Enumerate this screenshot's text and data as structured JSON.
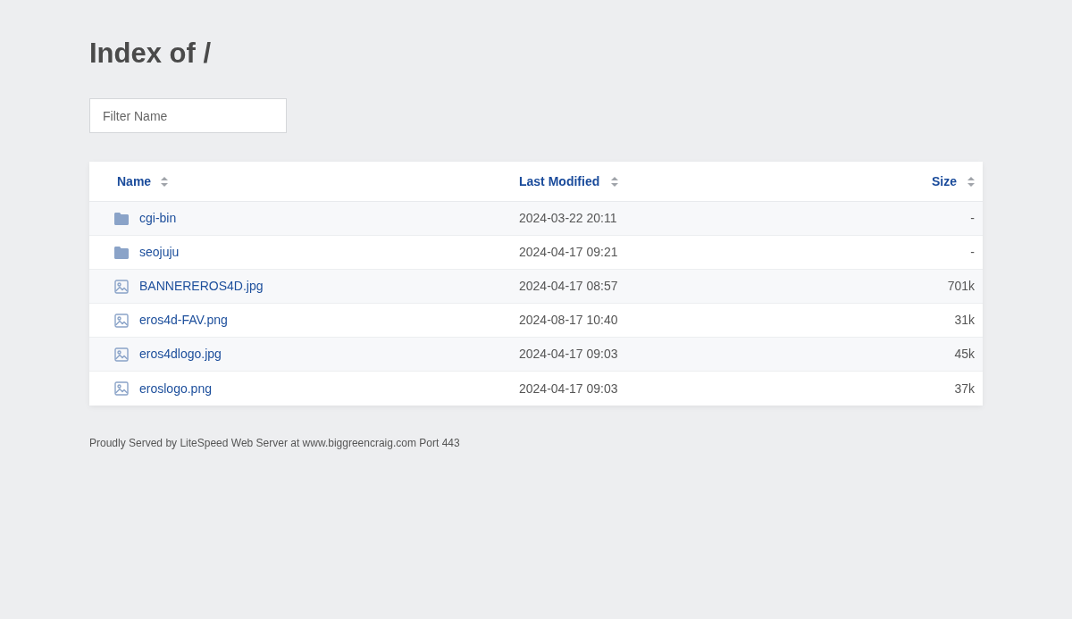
{
  "title": "Index of /",
  "filter": {
    "placeholder": "Filter Name"
  },
  "table": {
    "columns": [
      "Name",
      "Last Modified",
      "Size"
    ],
    "rows": [
      {
        "kind": "folder",
        "name": "cgi-bin",
        "modified": "2024-03-22 20:11",
        "size": "-"
      },
      {
        "kind": "folder",
        "name": "seojuju",
        "modified": "2024-04-17 09:21",
        "size": "-"
      },
      {
        "kind": "image",
        "name": "BANNEREROS4D.jpg",
        "modified": "2024-04-17 08:57",
        "size": "701k"
      },
      {
        "kind": "image",
        "name": "eros4d-FAV.png",
        "modified": "2024-08-17 10:40",
        "size": "31k"
      },
      {
        "kind": "image",
        "name": "eros4dlogo.jpg",
        "modified": "2024-04-17 09:03",
        "size": "45k"
      },
      {
        "kind": "image",
        "name": "eroslogo.png",
        "modified": "2024-04-17 09:03",
        "size": "37k"
      }
    ]
  },
  "footer": "Proudly Served by LiteSpeed Web Server at www.biggreencraig.com Port 443"
}
